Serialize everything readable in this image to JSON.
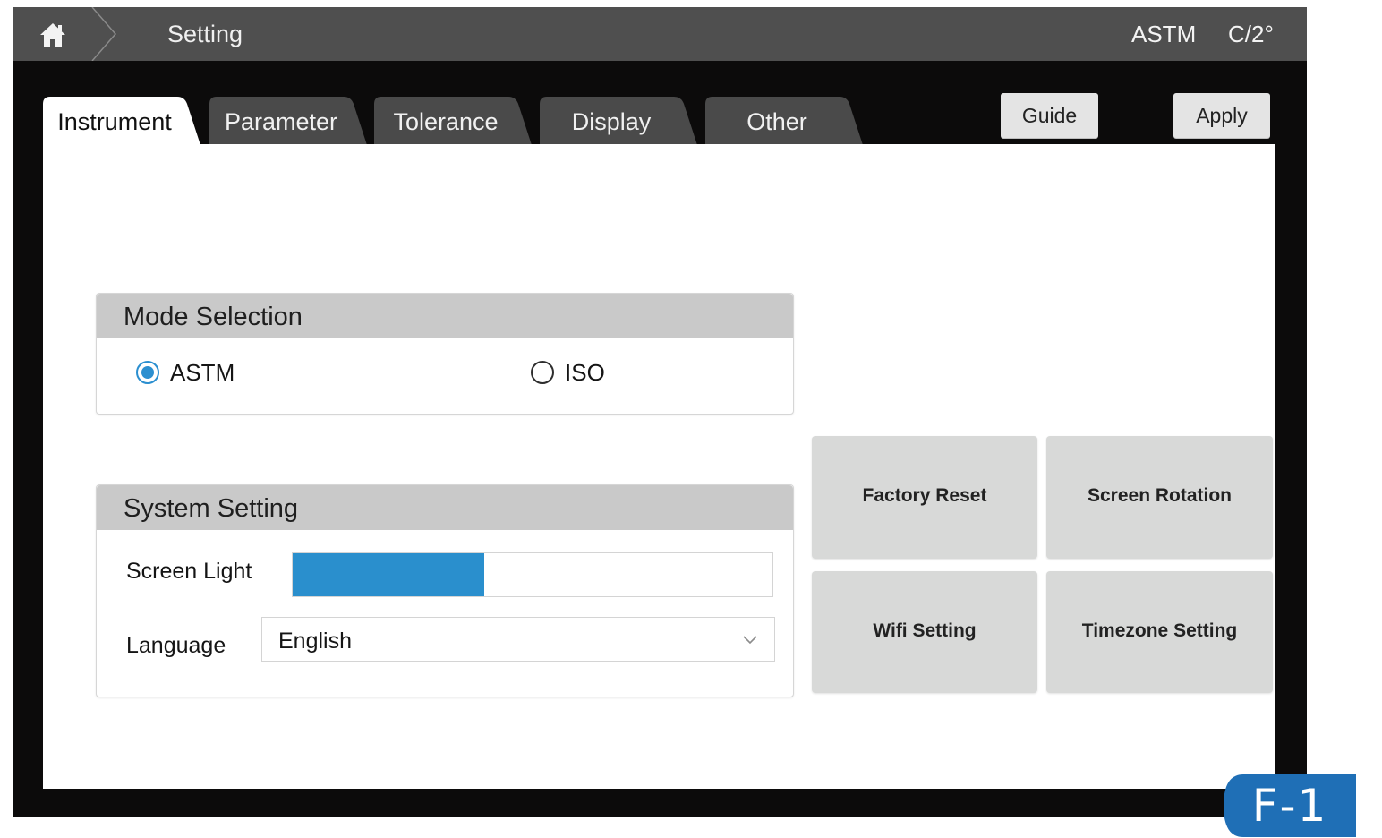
{
  "header": {
    "title": "Setting",
    "mode_indicator": "ASTM",
    "angle_indicator": "C/2°"
  },
  "tabs": [
    {
      "label": "Instrument",
      "active": true
    },
    {
      "label": "Parameter",
      "active": false
    },
    {
      "label": "Tolerance",
      "active": false
    },
    {
      "label": "Display",
      "active": false
    },
    {
      "label": "Other",
      "active": false
    }
  ],
  "toolbar": {
    "guide_label": "Guide",
    "apply_label": "Apply"
  },
  "mode_selection": {
    "title": "Mode Selection",
    "options": [
      {
        "label": "ASTM",
        "selected": true
      },
      {
        "label": "ISO",
        "selected": false
      }
    ]
  },
  "system_setting": {
    "title": "System Setting",
    "screen_light_label": "Screen Light",
    "screen_light_level_percent": 40,
    "language_label": "Language",
    "language_value": "English"
  },
  "actions": {
    "factory_reset": "Factory Reset",
    "screen_rotation": "Screen Rotation",
    "wifi_setting": "Wifi Setting",
    "timezone_setting": "Timezone Setting"
  },
  "figure_label": "F-1",
  "colors": {
    "accent": "#2b8fd0",
    "topbar": "#4f4f4f",
    "frame": "#0c0b0b",
    "tab_inactive": "#4a4a4a",
    "group_header": "#c9c9c9",
    "tile": "#d8d9d8",
    "figure_badge": "#1f6fb6"
  },
  "icons": {
    "home": "home-icon",
    "dropdown": "chevron-down-icon"
  }
}
